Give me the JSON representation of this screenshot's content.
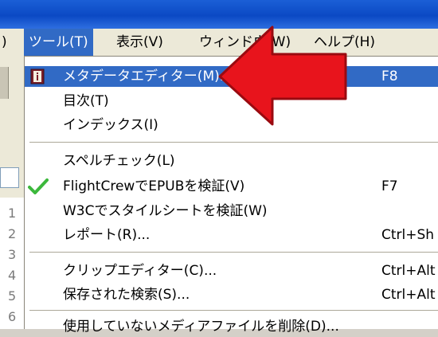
{
  "menubar": {
    "items": [
      {
        "label": ")"
      },
      {
        "label": "ツール(T)"
      },
      {
        "label": "表示(V)"
      },
      {
        "label": "ウィンドウ(W)"
      },
      {
        "label": "ヘルプ(H)"
      }
    ]
  },
  "line_numbers": [
    "1",
    "2",
    "3",
    "4",
    "5",
    "6"
  ],
  "dropdown": {
    "items": [
      {
        "label": "メタデータエディター(M)...",
        "shortcut": "F8",
        "icon": "metadata-book-icon",
        "highlighted": true
      },
      {
        "label": "目次(T)",
        "shortcut": ""
      },
      {
        "label": "インデックス(I)",
        "shortcut": ""
      },
      {
        "label": "スペルチェック(L)",
        "shortcut": ""
      },
      {
        "label": "FlightCrewでEPUBを検証(V)",
        "shortcut": "F7",
        "icon": "check-icon"
      },
      {
        "label": "W3Cでスタイルシートを検証(W)",
        "shortcut": ""
      },
      {
        "label": "レポート(R)...",
        "shortcut": "Ctrl+Sh"
      },
      {
        "label": "クリップエディター(C)...",
        "shortcut": "Ctrl+Alt"
      },
      {
        "label": "保存された検索(S)...",
        "shortcut": "Ctrl+Alt"
      },
      {
        "label": "使用していないメディアファイルを削除(D)...",
        "shortcut": ""
      }
    ]
  },
  "colors": {
    "highlight": "#316ac5",
    "arrow": "#e8141c",
    "check": "#3cb83c"
  }
}
